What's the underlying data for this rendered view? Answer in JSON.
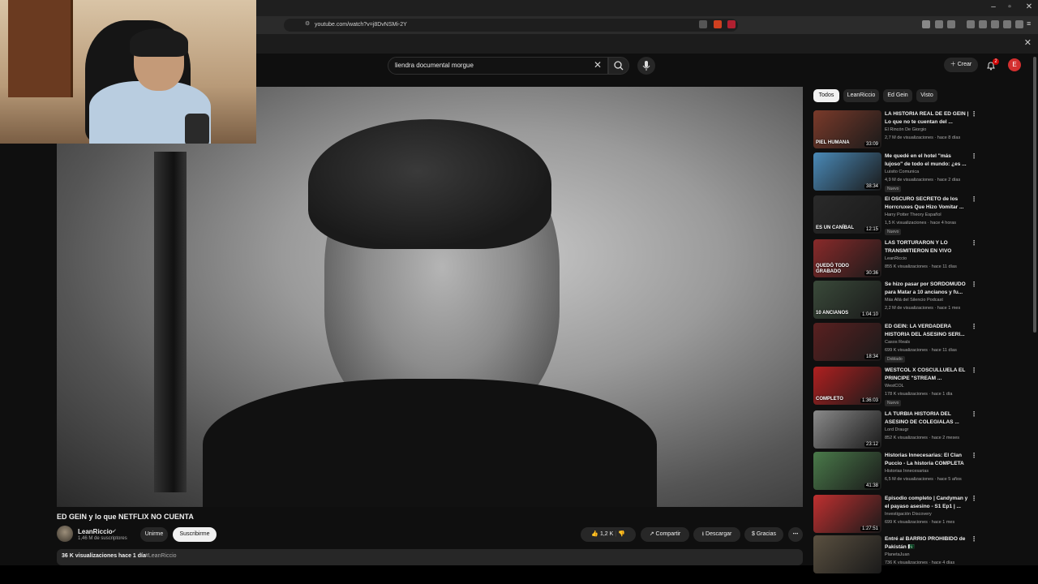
{
  "browser": {
    "url": "youtube.com/watch?v=j8DvNSMi-2Y"
  },
  "header": {
    "search_value": "liendra documental morgue",
    "create_label": "Crear",
    "notifications_count": "2",
    "avatar_letter": "E"
  },
  "video": {
    "title": "ED GEIN y lo que NETFLIX NO CUENTA",
    "channel": "LeanRiccio",
    "subscribers": "1,46 M de suscriptores",
    "join_label": "Unirme",
    "subscribe_label": "Suscribirme",
    "likes": "1,2 K",
    "share_label": "Compartir",
    "download_label": "Descargar",
    "thanks_label": "Gracias",
    "views_line": "36 K visualizaciones  hace 1 día",
    "hashtag": "#LeanRiccio"
  },
  "chips": [
    "Todos",
    "LeanRiccio",
    "Ed Gein",
    "Visto"
  ],
  "recommended": [
    {
      "title": "LA HISTORIA REAL DE ED GEIN | Lo que no te cuentan del ...",
      "channel": "El Rincón De Giorgio",
      "meta": "2,7 M de visualizaciones · hace 8 días",
      "duration": "33:09",
      "badge": "",
      "thumb": "#7a3a2a",
      "thumb_text": "PIEL HUMANA"
    },
    {
      "title": "Me quedé en el hotel \"más lujoso\" de todo el mundo: ¿es ...",
      "channel": "Luisito Comunica",
      "meta": "4,9 M de visualizaciones · hace 2 días",
      "duration": "38:34",
      "badge": "Nuevo",
      "thumb": "#4a8ab8",
      "thumb_text": ""
    },
    {
      "title": "El OSCURO SECRETO de los Horrcruxes Que Hizo Vomitar ...",
      "channel": "Harry Potter Theory Español",
      "meta": "1,5 K visualizaciones · hace 4 horas",
      "duration": "12:15",
      "badge": "Nuevo",
      "thumb": "#2a2a2a",
      "thumb_text": "ES UN CANÍBAL"
    },
    {
      "title": "LAS TORTURARON Y LO TRANSMITIERON EN VIVO",
      "channel": "LeanRiccio",
      "meta": "855 K visualizaciones · hace 11 días",
      "duration": "30:36",
      "badge": "",
      "thumb": "#8a2a2a",
      "thumb_text": "QUEDÓ TODO GRABADO"
    },
    {
      "title": "Se hizo pasar por SORDOMUDO para Matar a 10 ancianos y fu...",
      "channel": "Más Allá del Silencio Podcast",
      "meta": "2,2 M de visualizaciones · hace 1 mes",
      "duration": "1:04:10",
      "badge": "",
      "thumb": "#3a4a3a",
      "thumb_text": "10 ANCIANOS"
    },
    {
      "title": "ED GEIN: LA VERDADERA HISTORIA DEL ASESINO SERI...",
      "channel": "Casos Reals",
      "meta": "699 K visualizaciones · hace 11 días",
      "duration": "18:34",
      "badge": "Doblado",
      "thumb": "#5a2020",
      "thumb_text": ""
    },
    {
      "title": "WESTCOL X COSCULLUELA EL PRINCIPE \"STREAM ...",
      "channel": "WestCOL",
      "meta": "178 K visualizaciones · hace 1 día",
      "duration": "1:36:03",
      "badge": "Nuevo",
      "thumb": "#b02020",
      "thumb_text": "COMPLETO"
    },
    {
      "title": "LA TURBIA HISTORIA DEL ASESINO DE COLEGIALAS ...",
      "channel": "Lord Draugr",
      "meta": "852 K visualizaciones · hace 2 meses",
      "duration": "23:12",
      "badge": "",
      "thumb": "#8a8a8a",
      "thumb_text": ""
    },
    {
      "title": "Historias Innecesarias: El Clan Puccio - La historia COMPLETA",
      "channel": "Historias Innecesarias",
      "meta": "6,5 M de visualizaciones · hace 5 años",
      "duration": "41:38",
      "badge": "",
      "thumb": "#4a7a4a",
      "thumb_text": ""
    },
    {
      "title": "Episodio completo | Candyman y el payaso asesino - S1 Ep1 | ...",
      "channel": "Investigación Discovery",
      "meta": "699 K visualizaciones · hace 1 mes",
      "duration": "1:27:51",
      "badge": "",
      "thumb": "#c03030",
      "thumb_text": ""
    },
    {
      "title": "Entré al BARRIO PROHIBIDO de Pakistán 🇵🇰",
      "channel": "PlanetaJuan",
      "meta": "736 K visualizaciones · hace 4 días",
      "duration": "",
      "badge": "",
      "thumb": "#5a5040",
      "thumb_text": ""
    }
  ],
  "icons": {
    "search": "search-icon",
    "mic": "mic-icon",
    "bell": "bell-icon",
    "like": "thumbs-up-icon",
    "dislike": "thumbs-down-icon",
    "share": "share-icon",
    "download": "download-icon",
    "thanks": "dollar-icon"
  }
}
